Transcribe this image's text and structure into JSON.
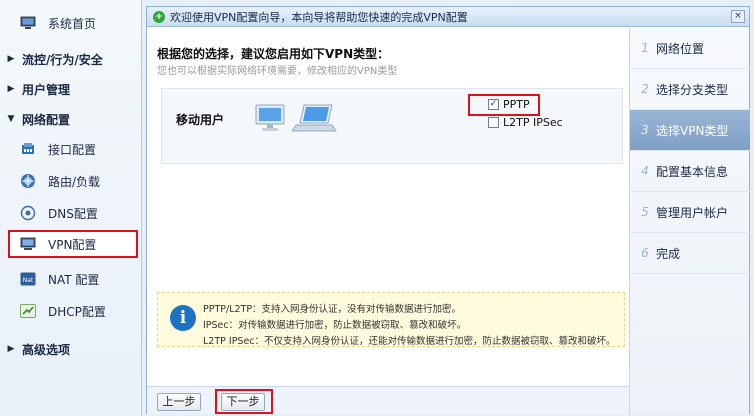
{
  "sidebar": {
    "items": [
      {
        "label": "系统首页",
        "type": "top",
        "icon": "monitor-icon"
      },
      {
        "label": "流控/行为/安全",
        "type": "section",
        "arrow": "▶"
      },
      {
        "label": "用户管理",
        "type": "section",
        "arrow": "▶"
      },
      {
        "label": "网络配置",
        "type": "section",
        "arrow": "▼"
      },
      {
        "label": "接口配置",
        "type": "sub",
        "icon": "interface-icon"
      },
      {
        "label": "路由/负载",
        "type": "sub",
        "icon": "route-icon"
      },
      {
        "label": "DNS配置",
        "type": "sub",
        "icon": "dns-icon"
      },
      {
        "label": "VPN配置",
        "type": "sub",
        "icon": "vpn-icon",
        "active": true
      },
      {
        "label": "NAT 配置",
        "type": "sub",
        "icon": "nat-icon"
      },
      {
        "label": "DHCP配置",
        "type": "sub",
        "icon": "dhcp-icon"
      },
      {
        "label": "高级选项",
        "type": "section",
        "arrow": "▶"
      }
    ]
  },
  "panel": {
    "title": "欢迎使用VPN配置向导，本向导将帮助您快速的完成VPN配置",
    "close": "×"
  },
  "content": {
    "heading": "根据您的选择，建议您启用如下VPN类型：",
    "subheading": "您也可以根据实际网络环境需要，修改相应的VPN类型",
    "vpn_label": "移动用户",
    "options": [
      {
        "label": "PPTP",
        "checked": true,
        "mark": "✓"
      },
      {
        "label": "L2TP IPSec",
        "checked": false,
        "mark": ""
      }
    ],
    "info": [
      "PPTP/L2TP：支持入网身份认证，没有对传输数据进行加密。",
      "IPSec：对传输数据进行加密，防止数据被窃取、篡改和破坏。",
      "L2TP IPSec：不仅支持入网身份认证，还能对传输数据进行加密，防止数据被窃取、篡改和破坏。"
    ]
  },
  "footer": {
    "prev_label": "上一步",
    "next_label": "下一步"
  },
  "steps": [
    {
      "num": "1",
      "label": "网络位置"
    },
    {
      "num": "2",
      "label": "选择分支类型"
    },
    {
      "num": "3",
      "label": "选择VPN类型",
      "active": true
    },
    {
      "num": "4",
      "label": "配置基本信息"
    },
    {
      "num": "5",
      "label": "管理用户帐户"
    },
    {
      "num": "6",
      "label": "完成"
    }
  ],
  "colors": {
    "highlight": "#e0101a",
    "active_step": "#8aa9cf",
    "info_bg": "#fffbdc",
    "info_icon": "#1d72c4"
  }
}
